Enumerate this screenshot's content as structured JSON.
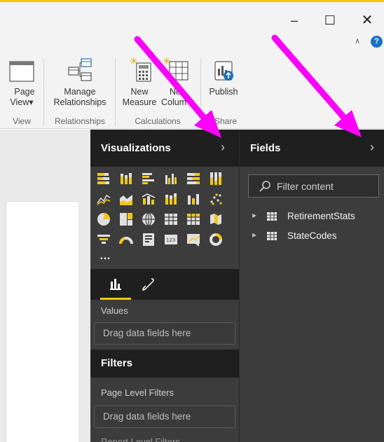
{
  "window": {
    "minimize_glyph": "–",
    "maximize_glyph": "☐",
    "close_glyph": "✕",
    "collapse_glyph": "∧",
    "help_glyph": "?"
  },
  "ribbon": {
    "buttons": [
      {
        "label": "Page",
        "label2": "View",
        "dropdown": "▾",
        "icon": "page-view-icon"
      },
      {
        "label": "Manage",
        "label2": "Relationships",
        "icon": "manage-relationships-icon"
      },
      {
        "label": "New",
        "label2": "Measure",
        "icon": "new-measure-icon"
      },
      {
        "label": "Ne",
        "label2": "Colum",
        "icon": "new-column-icon"
      },
      {
        "label": "Publish",
        "label2": "",
        "icon": "publish-icon"
      }
    ],
    "groups": [
      "View",
      "Relationships",
      "Calculations",
      "Share"
    ]
  },
  "visualizations": {
    "title": "Visualizations",
    "chevron": "›",
    "more": "…",
    "values_label": "Values",
    "values_drop": "Drag data fields here",
    "filters_title": "Filters",
    "page_filters_label": "Page Level Filters",
    "page_filters_drop": "Drag data fields here",
    "report_filters_label": "Report Level Filters",
    "tabs": [
      "fields-tab",
      "format-tab"
    ]
  },
  "fields": {
    "title": "Fields",
    "chevron": "›",
    "search_placeholder": "Filter content",
    "tables": [
      {
        "name": "RetirementStats",
        "expander": "▶"
      },
      {
        "name": "StateCodes",
        "expander": "▶"
      }
    ]
  },
  "colors": {
    "accent": "#f2c811",
    "annotation_arrow": "#ff00ff",
    "pane_bg": "#3c3c3c",
    "header_bg": "#1f1f1f"
  }
}
